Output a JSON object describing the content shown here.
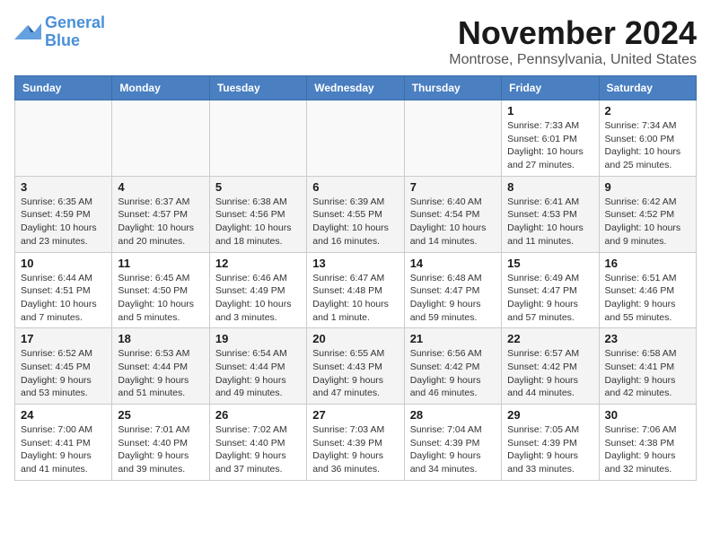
{
  "logo": {
    "line1": "General",
    "line2": "Blue"
  },
  "title": "November 2024",
  "location": "Montrose, Pennsylvania, United States",
  "days_of_week": [
    "Sunday",
    "Monday",
    "Tuesday",
    "Wednesday",
    "Thursday",
    "Friday",
    "Saturday"
  ],
  "weeks": [
    [
      {
        "day": "",
        "info": ""
      },
      {
        "day": "",
        "info": ""
      },
      {
        "day": "",
        "info": ""
      },
      {
        "day": "",
        "info": ""
      },
      {
        "day": "",
        "info": ""
      },
      {
        "day": "1",
        "info": "Sunrise: 7:33 AM\nSunset: 6:01 PM\nDaylight: 10 hours and 27 minutes."
      },
      {
        "day": "2",
        "info": "Sunrise: 7:34 AM\nSunset: 6:00 PM\nDaylight: 10 hours and 25 minutes."
      }
    ],
    [
      {
        "day": "3",
        "info": "Sunrise: 6:35 AM\nSunset: 4:59 PM\nDaylight: 10 hours and 23 minutes."
      },
      {
        "day": "4",
        "info": "Sunrise: 6:37 AM\nSunset: 4:57 PM\nDaylight: 10 hours and 20 minutes."
      },
      {
        "day": "5",
        "info": "Sunrise: 6:38 AM\nSunset: 4:56 PM\nDaylight: 10 hours and 18 minutes."
      },
      {
        "day": "6",
        "info": "Sunrise: 6:39 AM\nSunset: 4:55 PM\nDaylight: 10 hours and 16 minutes."
      },
      {
        "day": "7",
        "info": "Sunrise: 6:40 AM\nSunset: 4:54 PM\nDaylight: 10 hours and 14 minutes."
      },
      {
        "day": "8",
        "info": "Sunrise: 6:41 AM\nSunset: 4:53 PM\nDaylight: 10 hours and 11 minutes."
      },
      {
        "day": "9",
        "info": "Sunrise: 6:42 AM\nSunset: 4:52 PM\nDaylight: 10 hours and 9 minutes."
      }
    ],
    [
      {
        "day": "10",
        "info": "Sunrise: 6:44 AM\nSunset: 4:51 PM\nDaylight: 10 hours and 7 minutes."
      },
      {
        "day": "11",
        "info": "Sunrise: 6:45 AM\nSunset: 4:50 PM\nDaylight: 10 hours and 5 minutes."
      },
      {
        "day": "12",
        "info": "Sunrise: 6:46 AM\nSunset: 4:49 PM\nDaylight: 10 hours and 3 minutes."
      },
      {
        "day": "13",
        "info": "Sunrise: 6:47 AM\nSunset: 4:48 PM\nDaylight: 10 hours and 1 minute."
      },
      {
        "day": "14",
        "info": "Sunrise: 6:48 AM\nSunset: 4:47 PM\nDaylight: 9 hours and 59 minutes."
      },
      {
        "day": "15",
        "info": "Sunrise: 6:49 AM\nSunset: 4:47 PM\nDaylight: 9 hours and 57 minutes."
      },
      {
        "day": "16",
        "info": "Sunrise: 6:51 AM\nSunset: 4:46 PM\nDaylight: 9 hours and 55 minutes."
      }
    ],
    [
      {
        "day": "17",
        "info": "Sunrise: 6:52 AM\nSunset: 4:45 PM\nDaylight: 9 hours and 53 minutes."
      },
      {
        "day": "18",
        "info": "Sunrise: 6:53 AM\nSunset: 4:44 PM\nDaylight: 9 hours and 51 minutes."
      },
      {
        "day": "19",
        "info": "Sunrise: 6:54 AM\nSunset: 4:44 PM\nDaylight: 9 hours and 49 minutes."
      },
      {
        "day": "20",
        "info": "Sunrise: 6:55 AM\nSunset: 4:43 PM\nDaylight: 9 hours and 47 minutes."
      },
      {
        "day": "21",
        "info": "Sunrise: 6:56 AM\nSunset: 4:42 PM\nDaylight: 9 hours and 46 minutes."
      },
      {
        "day": "22",
        "info": "Sunrise: 6:57 AM\nSunset: 4:42 PM\nDaylight: 9 hours and 44 minutes."
      },
      {
        "day": "23",
        "info": "Sunrise: 6:58 AM\nSunset: 4:41 PM\nDaylight: 9 hours and 42 minutes."
      }
    ],
    [
      {
        "day": "24",
        "info": "Sunrise: 7:00 AM\nSunset: 4:41 PM\nDaylight: 9 hours and 41 minutes."
      },
      {
        "day": "25",
        "info": "Sunrise: 7:01 AM\nSunset: 4:40 PM\nDaylight: 9 hours and 39 minutes."
      },
      {
        "day": "26",
        "info": "Sunrise: 7:02 AM\nSunset: 4:40 PM\nDaylight: 9 hours and 37 minutes."
      },
      {
        "day": "27",
        "info": "Sunrise: 7:03 AM\nSunset: 4:39 PM\nDaylight: 9 hours and 36 minutes."
      },
      {
        "day": "28",
        "info": "Sunrise: 7:04 AM\nSunset: 4:39 PM\nDaylight: 9 hours and 34 minutes."
      },
      {
        "day": "29",
        "info": "Sunrise: 7:05 AM\nSunset: 4:39 PM\nDaylight: 9 hours and 33 minutes."
      },
      {
        "day": "30",
        "info": "Sunrise: 7:06 AM\nSunset: 4:38 PM\nDaylight: 9 hours and 32 minutes."
      }
    ]
  ]
}
